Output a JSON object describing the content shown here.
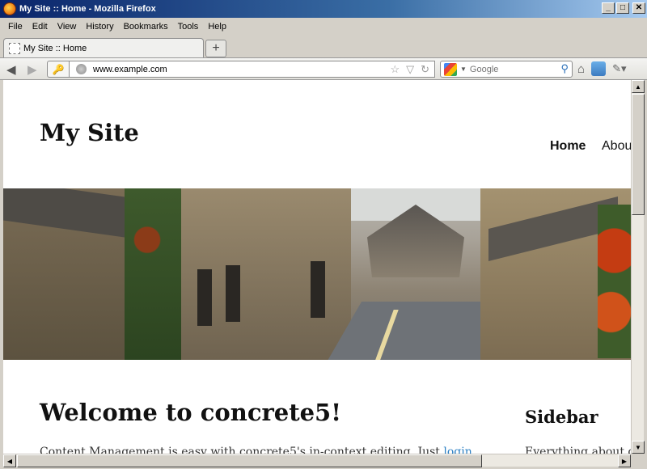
{
  "window": {
    "title": "My Site :: Home - Mozilla Firefox",
    "minimize": "_",
    "maximize": "□",
    "close": "✕"
  },
  "menu": [
    "File",
    "Edit",
    "View",
    "History",
    "Bookmarks",
    "Tools",
    "Help"
  ],
  "tab": {
    "label": "My Site :: Home",
    "new_tab": "+"
  },
  "navbar": {
    "back": "◀",
    "forward": "▶",
    "key": "🔑",
    "url": "www.example.com",
    "star": "☆",
    "dropmark": "▽",
    "reload": "↻",
    "search_placeholder": "Google",
    "search_icon": "⚲",
    "home": "⌂",
    "addon": "✎▾"
  },
  "page": {
    "site_title": "My Site",
    "nav": [
      "Home",
      "Abou"
    ],
    "heading": "Welcome to concrete5!",
    "body_text_before_link": "Content Management is easy with concrete5's in-context editing. Just ",
    "body_link": "login",
    "sidebar_title": "Sidebar",
    "sidebar_text": "Everything about c"
  },
  "scrollbar": {
    "up": "▲",
    "down": "▼",
    "left": "◀",
    "right": "▶"
  }
}
